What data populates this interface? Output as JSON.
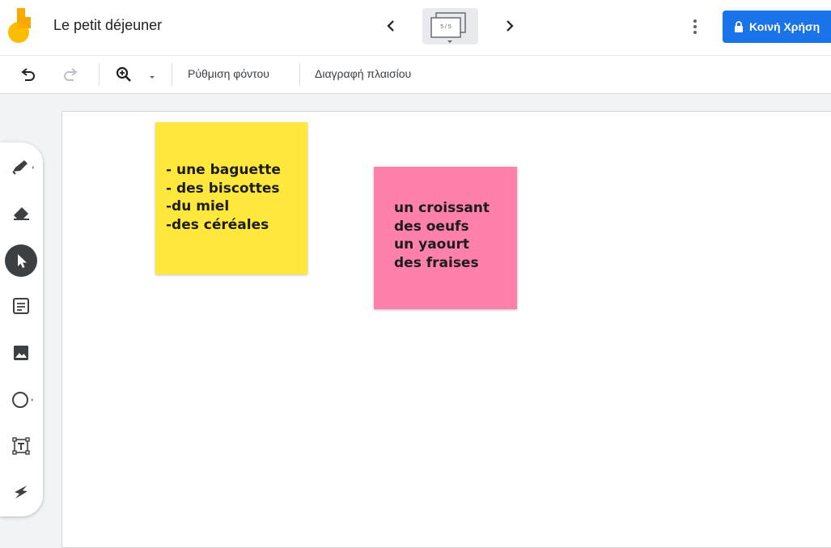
{
  "app": {
    "title": "Le petit déjeuner",
    "frame_counter": "5 / 5",
    "share_label": "Κοινή Χρήση",
    "brand_colors": {
      "accent": "#1a73e8",
      "logo_yellow": "#fbbc04",
      "logo_orange": "#f9ab00"
    }
  },
  "toolbar": {
    "background_label": "Ρύθμιση φόντου",
    "delete_frame_label": "Διαγραφή πλαισίου",
    "icons": [
      "undo-icon",
      "redo-icon",
      "zoom-icon",
      "dropdown-icon"
    ]
  },
  "tools": [
    "pen-icon",
    "eraser-icon",
    "select-icon",
    "sticky-note-icon",
    "image-icon",
    "circle-icon",
    "text-box-icon",
    "laser-icon"
  ],
  "canvas": {
    "notes": [
      {
        "color": "#ffe83b",
        "lines": [
          "- une baguette",
          "- des biscottes",
          "-du miel",
          "-des céréales"
        ]
      },
      {
        "color": "#ff80aa",
        "lines": [
          "un croissant",
          "des oeufs",
          "un yaourt",
          "des fraises"
        ]
      }
    ]
  }
}
